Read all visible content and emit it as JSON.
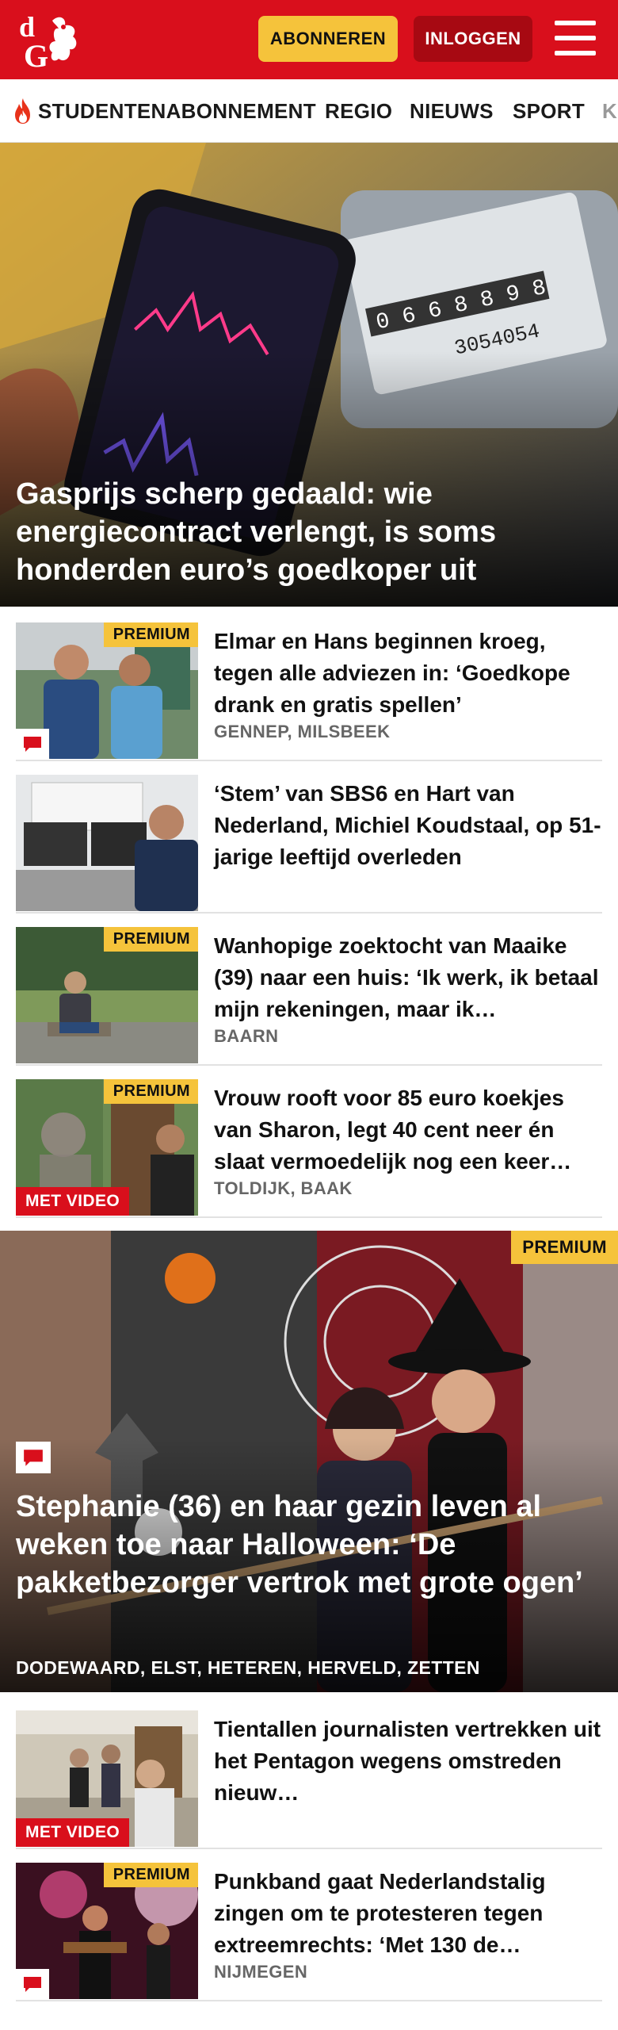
{
  "header": {
    "logo_text": "dG",
    "subscribe_label": "ABONNEREN",
    "login_label": "INLOGGEN",
    "menu_icon": "hamburger-menu-icon",
    "brand_color": "#d90f1c",
    "accent_color": "#f5c33b"
  },
  "nav": {
    "items": [
      {
        "label": "STUDENTENABONNEMENT",
        "icon": "flame-icon"
      },
      {
        "label": "REGIO"
      },
      {
        "label": "NIEUWS"
      },
      {
        "label": "SPORT"
      },
      {
        "label": "K"
      }
    ]
  },
  "hero": {
    "title": "Gasprijs scherp gedaald: wie energiecontract verlengt, is soms honderden euro’s goedkoper uit"
  },
  "articles": [
    {
      "title": "Elmar en Hans beginnen kroeg, tegen alle adviezen in: ‘Goedkope drank en gratis spellen’",
      "location": "GENNEP, MILSBEEK",
      "premium": "PREMIUM",
      "comment_icon": "comment-icon"
    },
    {
      "title": "‘Stem’ van SBS6 en Hart van Nederland, Michiel Koudstaal, op 51-jarige leeftijd overleden"
    },
    {
      "title": "Wanhopige zoektocht van Maaike (39) naar een huis: ‘Ik werk, ik betaal mijn rekeningen, maar ik…",
      "location": "BAARN",
      "premium": "PREMIUM"
    },
    {
      "title": "Vrouw rooft voor 85 euro koekjes van Sharon, legt 40 cent neer én slaat vermoedelijk nog een keer…",
      "location": "TOLDIJK, BAAK",
      "premium": "PREMIUM",
      "video": "MET VIDEO"
    }
  ],
  "big_article": {
    "title": "Stephanie (36) en haar gezin leven al weken toe naar Halloween: ‘De pakketbezorger vertrok met grote ogen’",
    "location": "DODEWAARD, ELST, HETEREN, HERVELD, ZETTEN",
    "premium": "PREMIUM",
    "comment_icon": "comment-icon"
  },
  "articles2": [
    {
      "title": "Tientallen journalisten vertrekken uit het Pentagon wegens omstreden nieuw…",
      "video": "MET VIDEO"
    },
    {
      "title": "Punkband gaat Nederlandstalig zingen om te protesteren tegen extreemrechts: ‘Met 130 de…",
      "location": "NIJMEGEN",
      "premium": "PREMIUM",
      "comment_icon": "comment-icon"
    }
  ]
}
